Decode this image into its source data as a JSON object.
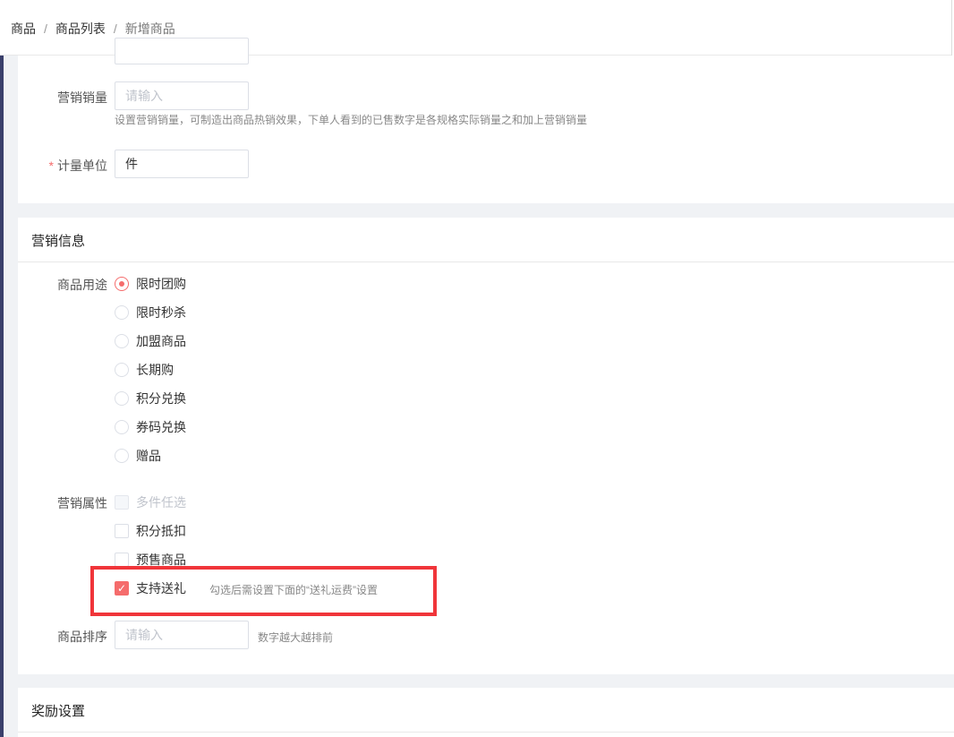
{
  "breadcrumb": {
    "item1": "商品",
    "item2": "商品列表",
    "current": "新增商品",
    "sep": "/"
  },
  "basic": {
    "marketing_sales_label": "营销销量",
    "marketing_sales_placeholder": "请输入",
    "marketing_sales_hint": "设置营销销量，可制造出商品热销效果，下单人看到的已售数字是各规格实际销量之和加上营销销量",
    "unit_required_mark": "*",
    "unit_label": "计量单位",
    "unit_value": "件"
  },
  "marketing": {
    "title": "营销信息",
    "usage_label": "商品用途",
    "usage_options": [
      "限时团购",
      "限时秒杀",
      "加盟商品",
      "长期购",
      "积分兑换",
      "券码兑换",
      "赠品"
    ],
    "usage_selected": "限时团购",
    "attr_label": "营销属性",
    "attr_options": [
      {
        "label": "多件任选",
        "checked": false,
        "disabled": true
      },
      {
        "label": "积分抵扣",
        "checked": false,
        "disabled": false
      },
      {
        "label": "预售商品",
        "checked": false,
        "disabled": false
      },
      {
        "label": "支持送礼",
        "checked": true,
        "disabled": false
      }
    ],
    "gift_hint": "勾选后需设置下面的“送礼运费”设置",
    "sort_label": "商品排序",
    "sort_placeholder": "请输入",
    "sort_hint": "数字越大越排前"
  },
  "reward": {
    "title": "奖励设置"
  },
  "colors": {
    "accent": "#f56c6c",
    "highlight_box": "#f0353a"
  }
}
